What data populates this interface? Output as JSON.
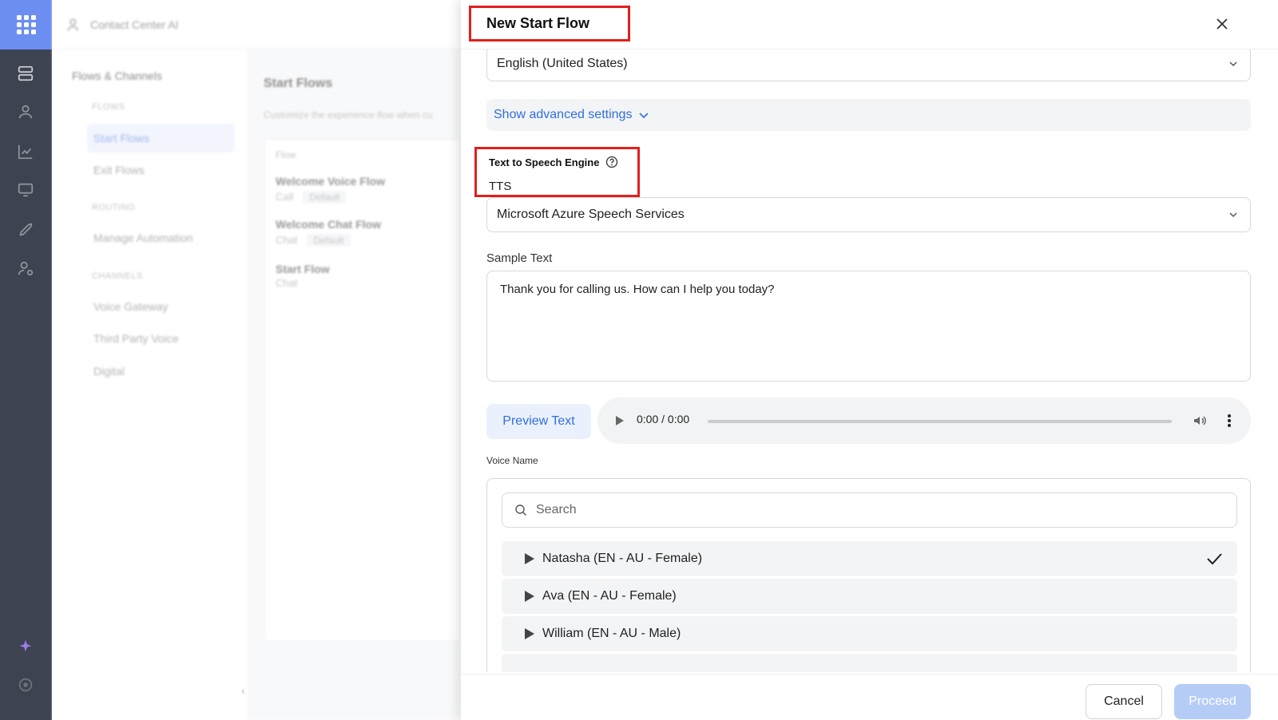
{
  "background": {
    "app_name": "Contact Center AI",
    "sidebar": {
      "heading": "Flows & Channels",
      "sections": [
        {
          "label": "FLOWS",
          "items": [
            "Start Flows",
            "Exit Flows"
          ]
        },
        {
          "label": "ROUTING",
          "items": [
            "Manage Automation"
          ]
        },
        {
          "label": "CHANNELS",
          "items": [
            "Voice Gateway",
            "Third Party Voice",
            "Digital"
          ]
        }
      ]
    },
    "main": {
      "title": "Start Flows",
      "subtitle": "Customize the experience flow when cu",
      "column_header": "Flow",
      "rows": [
        {
          "name": "Welcome Voice Flow",
          "type": "Call",
          "tag": "Default"
        },
        {
          "name": "Welcome Chat Flow",
          "type": "Chat",
          "tag": "Default"
        },
        {
          "name": "Start Flow",
          "type": "Chat",
          "tag": ""
        }
      ]
    }
  },
  "modal": {
    "title": "New Start Flow",
    "language_value": "English (United States)",
    "advanced_label": "Show advanced settings",
    "tts_label": "Text to Speech Engine",
    "tts_value": "TTS",
    "engine_value": "Microsoft Azure Speech Services",
    "sample_label": "Sample Text",
    "sample_text": "Thank you for calling us. How can I help you today?",
    "preview_label": "Preview Text",
    "audio_time": "0:00 / 0:00",
    "voice_label": "Voice Name",
    "search_placeholder": "Search",
    "voices": [
      {
        "name": "Natasha (EN - AU - Female)",
        "selected": true
      },
      {
        "name": "Ava (EN - AU - Female)",
        "selected": false
      },
      {
        "name": "William (EN - AU - Male)",
        "selected": false
      }
    ],
    "cancel_label": "Cancel",
    "proceed_label": "Proceed"
  },
  "colors": {
    "accent": "#2f6fde",
    "highlight": "#e0201c",
    "rail": "#3d4350",
    "rail_active": "#6b8ef0"
  }
}
